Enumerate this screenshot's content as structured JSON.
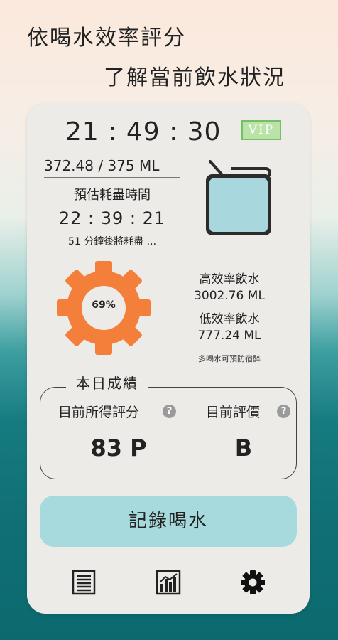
{
  "headline": {
    "line1": "依喝水效率評分",
    "line2": "了解當前飲水狀況"
  },
  "status": {
    "clock": "21 : 49 : 30",
    "vip_label": "VIP",
    "remaining": "372.48 / 375 ML",
    "estimate_label": "預估耗盡時間",
    "estimate_time": "22 : 39 : 21",
    "estimate_note": "51 分鐘後將耗盡 ...",
    "container_fill": 0.99
  },
  "efficiency": {
    "percent": "69%",
    "high_label": "高效率飲水",
    "high_value": "3002.76 ML",
    "low_label": "低效率飲水",
    "low_value": "777.24 ML",
    "tip": "多喝水可預防宿醉"
  },
  "score": {
    "section_title": "本日成績",
    "points_label": "目前所得評分",
    "points_value": "83 P",
    "grade_label": "目前評價",
    "grade_value": "B",
    "help_glyph": "?"
  },
  "actions": {
    "record_label": "記錄喝水"
  },
  "nav": {
    "icons": [
      "list-icon",
      "bar-chart-icon",
      "gear-icon"
    ]
  },
  "colors": {
    "accent": "#a7dadd",
    "gear": "#f47f3b",
    "vip": "#77be69",
    "water": "#a8d8de"
  }
}
